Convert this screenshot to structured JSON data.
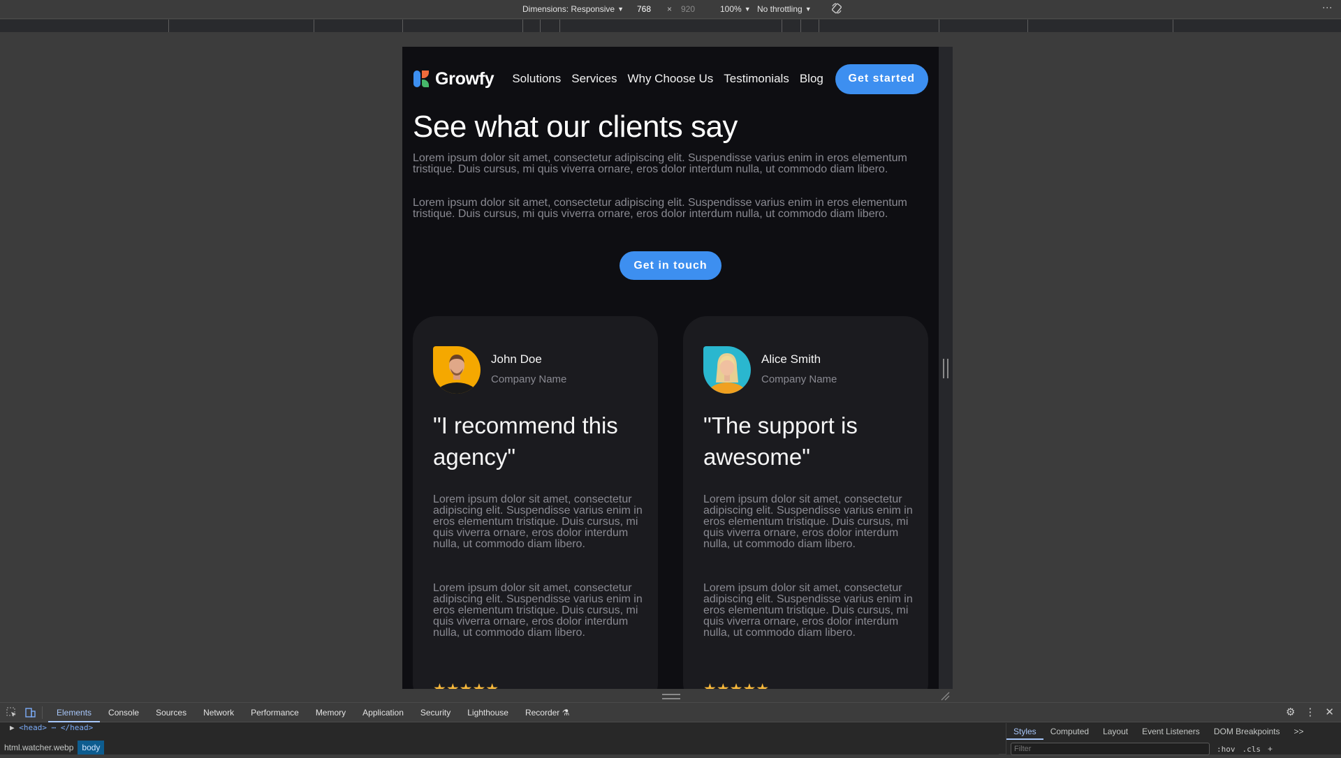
{
  "device_toolbar": {
    "dimensions_label": "Dimensions: Responsive",
    "width": "768",
    "times": "×",
    "height": "920",
    "zoom": "100%",
    "throttling": "No throttling"
  },
  "site": {
    "brand": "Growfy",
    "nav_links": [
      "Solutions",
      "Services",
      "Why Choose Us",
      "Testimonials",
      "Blog"
    ],
    "nav_cta": "Get started",
    "hero": {
      "title": "See what our clients say",
      "paragraphs": [
        "Lorem ipsum dolor sit amet, consectetur adipiscing elit. Suspendisse varius enim in eros elementum tristique. Duis cursus, mi quis viverra ornare, eros dolor interdum nulla, ut commodo diam libero.",
        "Lorem ipsum dolor sit amet, consectetur adipiscing elit. Suspendisse varius enim in eros elementum tristique. Duis cursus, mi quis viverra ornare, eros dolor interdum nulla, ut commodo diam libero."
      ],
      "cta": "Get in touch"
    },
    "testimonials": [
      {
        "name": "John Doe",
        "company": "Company Name",
        "quote": "\"I recommend this agency\"",
        "paragraphs": [
          "Lorem ipsum dolor sit amet, consectetur adipiscing elit. Suspendisse varius enim in eros elementum tristique. Duis cursus, mi quis viverra ornare, eros dolor interdum nulla, ut commodo diam libero.",
          "Lorem ipsum dolor sit amet, consectetur adipiscing elit. Suspendisse varius enim in eros elementum tristique. Duis cursus, mi quis viverra ornare, eros dolor interdum nulla, ut commodo diam libero."
        ],
        "rating": 5,
        "avatar_bg": "#f5a800"
      },
      {
        "name": "Alice Smith",
        "company": "Company Name",
        "quote": "\"The support is awesome\"",
        "paragraphs": [
          "Lorem ipsum dolor sit amet, consectetur adipiscing elit. Suspendisse varius enim in eros elementum tristique. Duis cursus, mi quis viverra ornare, eros dolor interdum nulla, ut commodo diam libero.",
          "Lorem ipsum dolor sit amet, consectetur adipiscing elit. Suspendisse varius enim in eros elementum tristique. Duis cursus, mi quis viverra ornare, eros dolor interdum nulla, ut commodo diam libero."
        ],
        "rating": 5,
        "avatar_bg": "#2ab7cf"
      }
    ],
    "stars": "★★★★★",
    "colors": {
      "accent": "#3d8ff0",
      "star": "#f7b83b",
      "bg": "#0e0e12",
      "card": "#1b1b1f"
    }
  },
  "devtools": {
    "tabs": [
      "Elements",
      "Console",
      "Sources",
      "Network",
      "Performance",
      "Memory",
      "Application",
      "Security",
      "Lighthouse",
      "Recorder"
    ],
    "active_tab": "Elements",
    "dom_line": "<head> ⋯ </head>",
    "breadcrumbs": [
      "html.watcher.webp",
      "body"
    ],
    "styles_tabs": [
      "Styles",
      "Computed",
      "Layout",
      "Event Listeners",
      "DOM Breakpoints",
      ">>"
    ],
    "filter_placeholder": "Filter",
    "hov": ":hov",
    "cls": ".cls",
    "plus": "+"
  }
}
